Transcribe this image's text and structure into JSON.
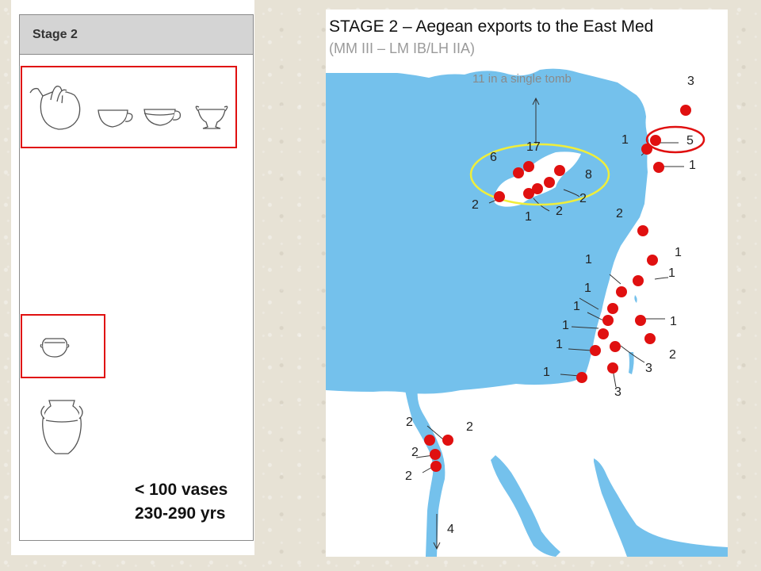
{
  "left_panel": {
    "header": "Stage 2",
    "summary_vases": "< 100 vases",
    "summary_years": "230-290 yrs",
    "highlight_color": "#e01010",
    "vessel_icons": [
      "jug-icon",
      "cup-icon",
      "handled-cup-icon",
      "kylix-icon",
      "squat-jar-icon",
      "amphora-icon"
    ]
  },
  "map": {
    "title": "STAGE 2 – Aegean exports to the East Med",
    "subtitle": "(MM III – LM IB/LH IIA)",
    "annotation": "11 in a single tomb",
    "sea_color": "#74c1ec",
    "land_color": "#ffffff",
    "marker_color": "#e01010",
    "cyprus_ring_color": "#f0ee3a",
    "labels": [
      "3",
      "17",
      "6",
      "8",
      "2",
      "2",
      "2",
      "1",
      "1",
      "5",
      "1",
      "2",
      "1",
      "1",
      "1",
      "1",
      "1",
      "1",
      "1",
      "1",
      "2",
      "3",
      "3",
      "1",
      "2",
      "2",
      "2",
      "2",
      "4"
    ]
  }
}
